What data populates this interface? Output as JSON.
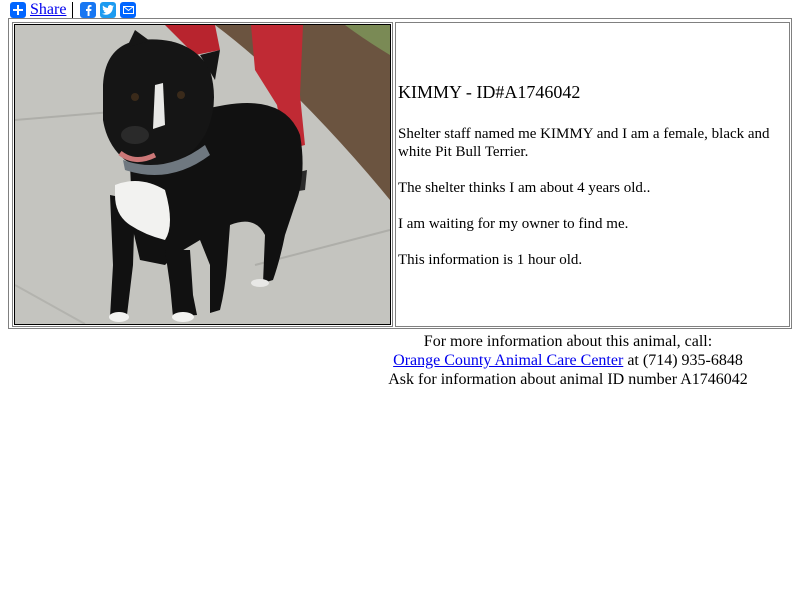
{
  "share": {
    "label": "Share",
    "icons": [
      "plus-icon",
      "facebook-icon",
      "twitter-icon",
      "email-icon"
    ]
  },
  "animal": {
    "title": "KIMMY - ID#A1746042",
    "description_1": "Shelter staff named me KIMMY and I am a female, black and white Pit Bull Terrier.",
    "description_2": "The shelter thinks I am about 4 years old..",
    "description_3": "I am waiting for my owner to find me.",
    "description_4": "This information is 1 hour old."
  },
  "footer": {
    "line1": "For more information about this animal, call:",
    "shelter_link": "Orange County Animal Care Center",
    "phone_text": " at (714) 935-6848",
    "line3": "Ask for information about animal ID number A1746042"
  },
  "colors": {
    "link": "#0000ee",
    "share_blue": "#0166ff",
    "facebook_blue": "#1877f2",
    "twitter_blue": "#1d9bf0"
  }
}
